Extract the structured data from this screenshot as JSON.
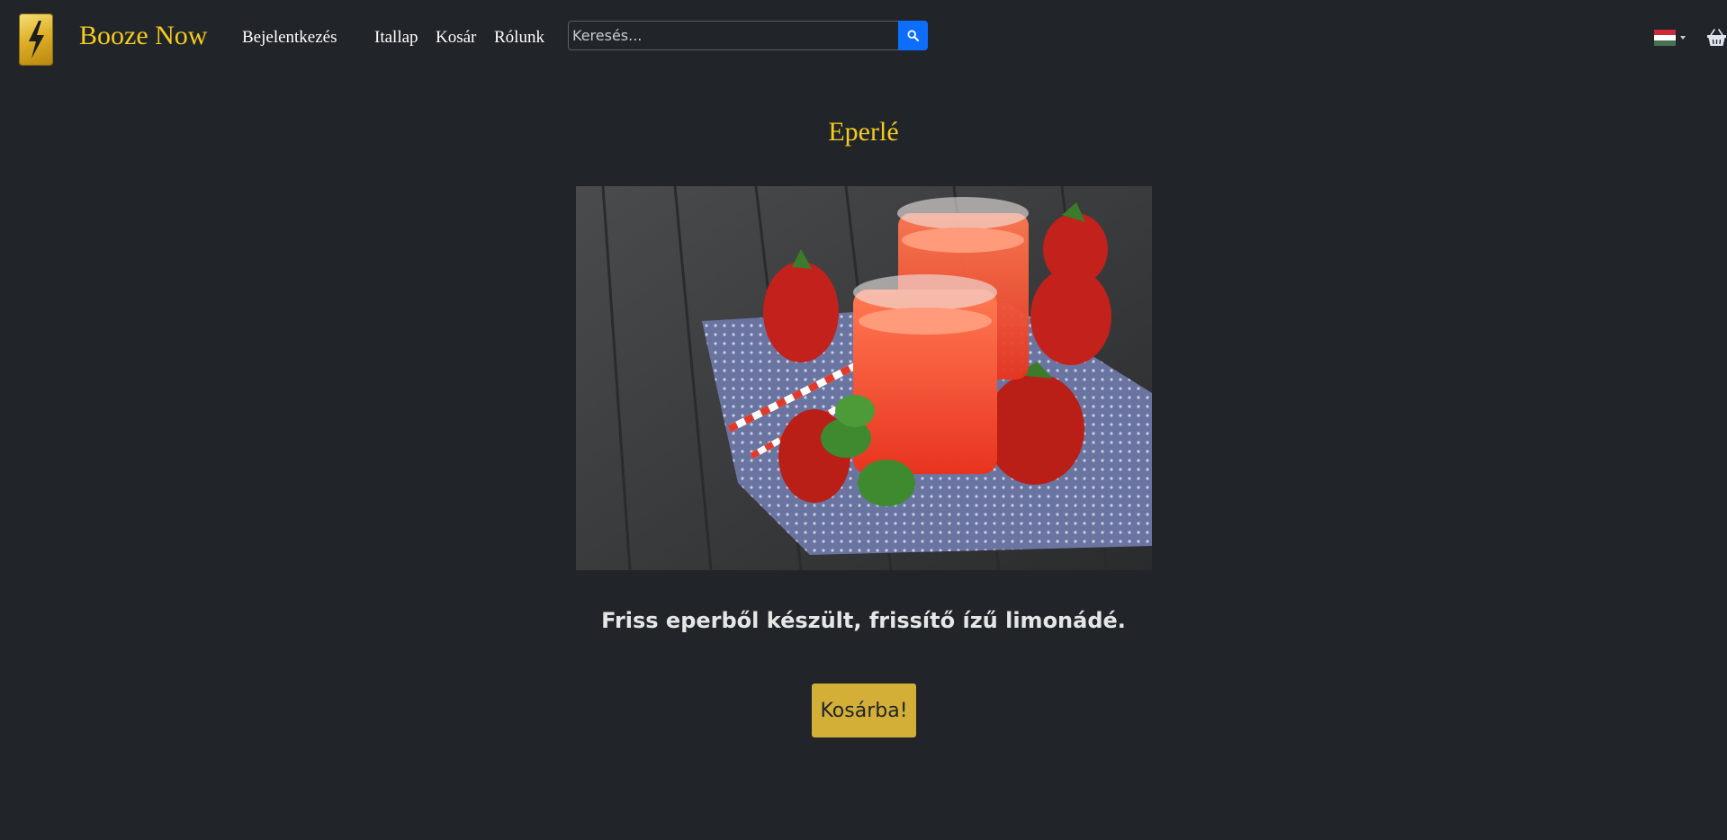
{
  "navbar": {
    "brand": "Booze Now",
    "links": {
      "login": "Bejelentkezés",
      "menu": "Itallap",
      "cart": "Kosár",
      "about": "Rólunk"
    },
    "search": {
      "placeholder": "Keresés...",
      "icon": "search-icon"
    },
    "language_flag": "hungarian-flag-icon",
    "basket_icon": "shopping-basket-icon"
  },
  "product": {
    "title": "Eperlé",
    "image_description": "Two glasses of strawberry juice with strawberries, mint and straws on a blue polka-dot napkin on dark wooden boards",
    "description": "Friss eperből készült, frissítő ízű limonádé.",
    "add_to_cart": "Kosárba!"
  },
  "colors": {
    "background": "#212429",
    "accent": "#f3cc20",
    "button": "#d4af37",
    "search_button": "#0d6efd"
  }
}
